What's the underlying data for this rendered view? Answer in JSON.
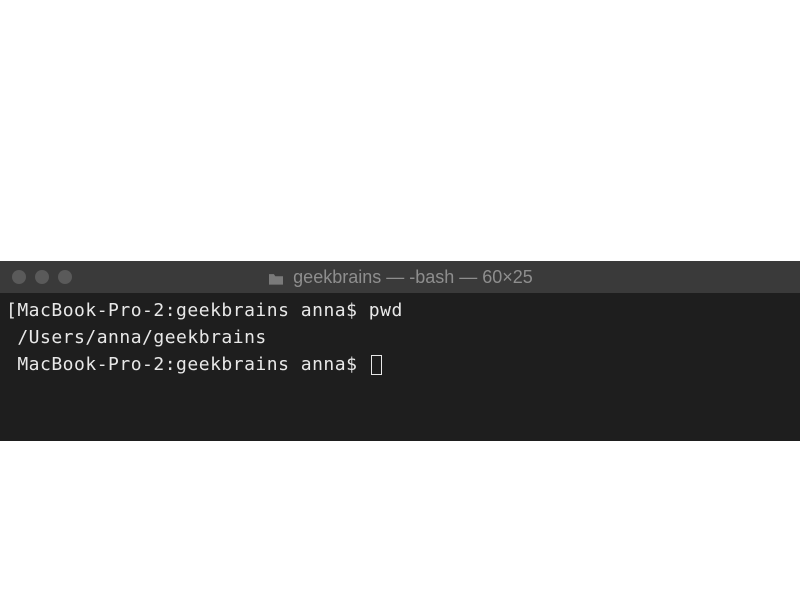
{
  "titlebar": {
    "folder_icon": "folder-icon",
    "title": "geekbrains — -bash — 60×25"
  },
  "terminal": {
    "lines": [
      {
        "prompt": "MacBook-Pro-2:geekbrains anna$ ",
        "command": "pwd",
        "leading_bracket": "["
      },
      {
        "output": " /Users/anna/geekbrains"
      },
      {
        "prompt": " MacBook-Pro-2:geekbrains anna$ ",
        "cursor": true
      }
    ]
  }
}
